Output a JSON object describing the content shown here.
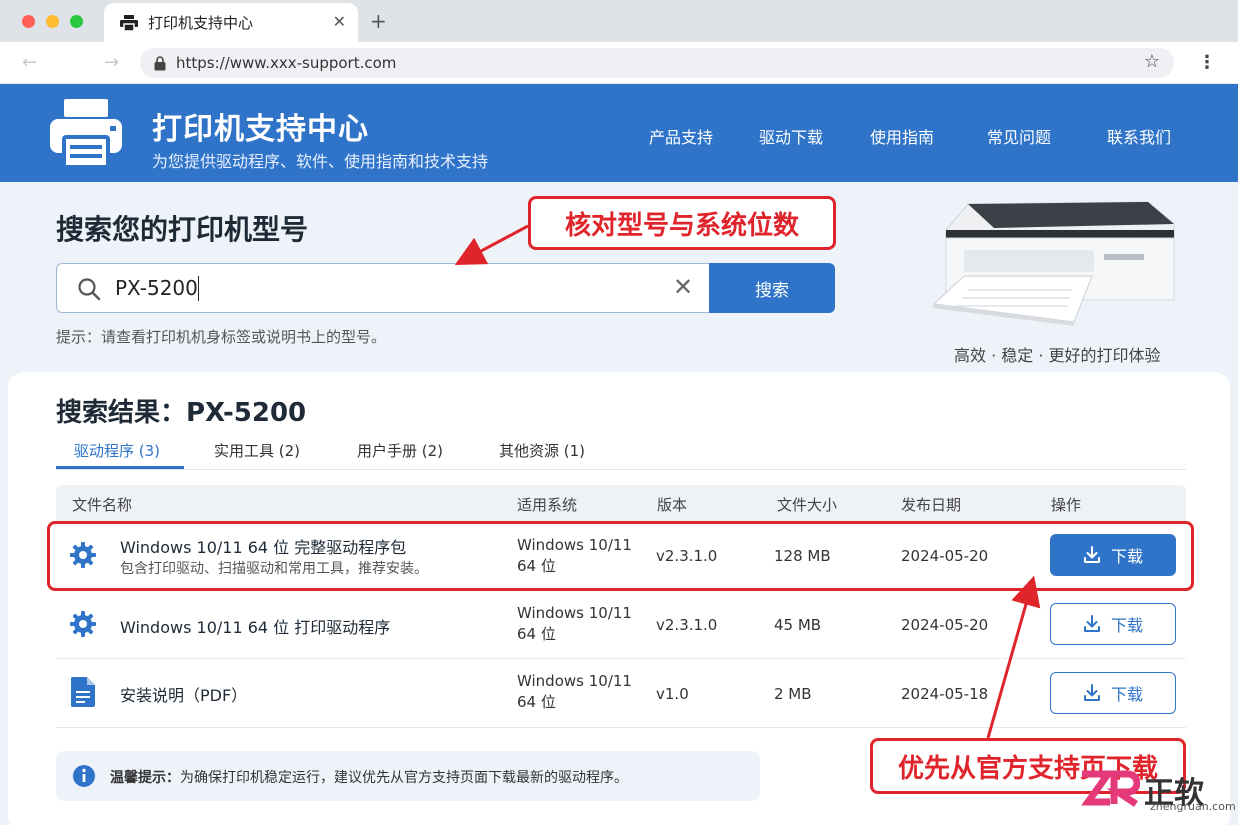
{
  "browser": {
    "tab_title": "打印机支持中心",
    "tab_close": "✕",
    "new_tab": "+",
    "url": "https://www.xxx-support.com"
  },
  "header": {
    "title": "打印机支持中心",
    "subtitle": "为您提供驱动程序、软件、使用指南和技术支持",
    "nav": [
      "产品支持",
      "驱动下载",
      "使用指南",
      "常见问题",
      "联系我们"
    ]
  },
  "search": {
    "title": "搜索您的打印机型号",
    "value": "PX-5200",
    "button": "搜索",
    "hint": "提示：请查看打印机机身标签或说明书上的型号。",
    "tagline": "高效 · 稳定 · 更好的打印体验"
  },
  "results": {
    "title": "搜索结果：PX-5200",
    "tabs": [
      "驱动程序 (3)",
      "实用工具 (2)",
      "用户手册 (2)",
      "其他资源 (1)"
    ],
    "columns": [
      "文件名称",
      "适用系统",
      "版本",
      "文件大小",
      "发布日期",
      "操作"
    ],
    "rows": [
      {
        "icon": "gear-icon",
        "name": "Windows 10/11 64 位 完整驱动程序包",
        "desc": "包含打印驱动、扫描驱动和常用工具，推荐安装。",
        "sys1": "Windows 10/11",
        "sys2": "64 位",
        "version": "v2.3.1.0",
        "size": "128 MB",
        "date": "2024-05-20",
        "action": "下载"
      },
      {
        "icon": "gear-icon",
        "name": "Windows 10/11 64 位 打印驱动程序",
        "desc": "",
        "sys1": "Windows 10/11",
        "sys2": "64 位",
        "version": "v2.3.1.0",
        "size": "45 MB",
        "date": "2024-05-20",
        "action": "下载"
      },
      {
        "icon": "document-icon",
        "name": "安装说明（PDF）",
        "desc": "",
        "sys1": "Windows 10/11",
        "sys2": "64 位",
        "version": "v1.0",
        "size": "2 MB",
        "date": "2024-05-18",
        "action": "下载"
      }
    ],
    "notice_label": "温馨提示：",
    "notice_text": "为确保打印机稳定运行，建议优先从官方支持页面下载最新的驱动程序。"
  },
  "annotations": {
    "callout_model": "核对型号与系统位数",
    "callout_official": "优先从官方支持页下载"
  },
  "watermark": {
    "brand": "正软",
    "domain": "zhengruan.com"
  },
  "colors": {
    "brand_blue": "#2f74c8",
    "annotation_red": "#e0242b"
  }
}
